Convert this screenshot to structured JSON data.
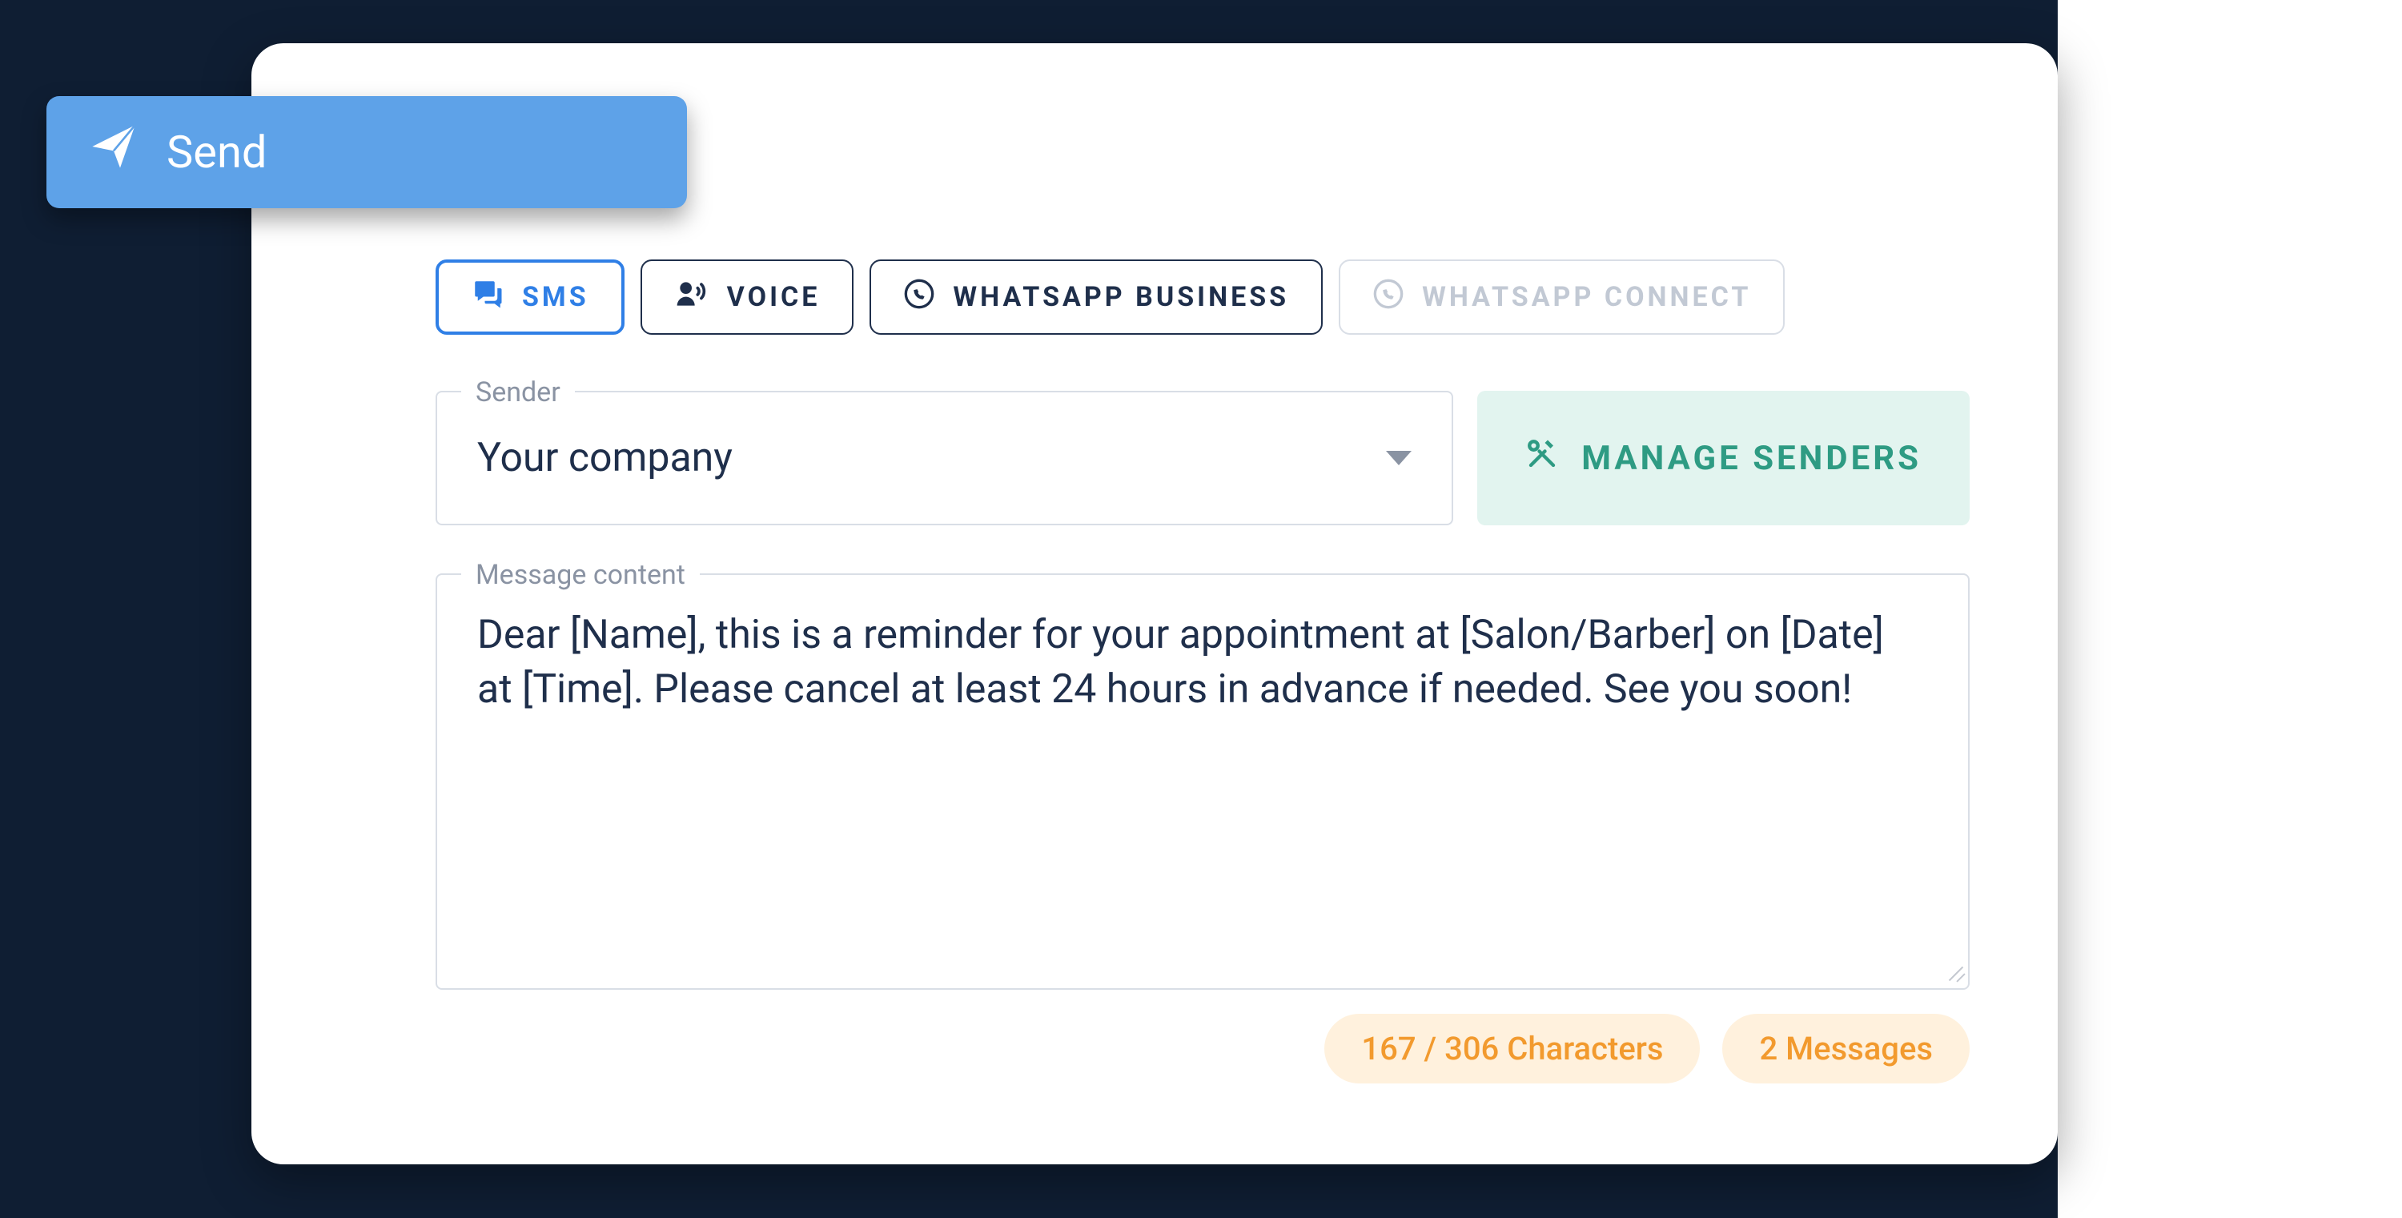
{
  "send_button": {
    "label": "Send"
  },
  "tabs": {
    "sms": "SMS",
    "voice": "VOICE",
    "whatsapp_business": "WHATSAPP BUSINESS",
    "whatsapp_connect": "WHATSAPP CONNECT"
  },
  "sender": {
    "legend": "Sender",
    "value": "Your company",
    "manage_label": "MANAGE SENDERS"
  },
  "message": {
    "legend": "Message content",
    "value": "Dear [Name], this is a reminder for your appointment at [Salon/Barber] on [Date] at [Time]. Please cancel at least 24 hours in advance if needed. See you soon!"
  },
  "counters": {
    "characters": "167 / 306 Characters",
    "messages": "2 Messages"
  }
}
